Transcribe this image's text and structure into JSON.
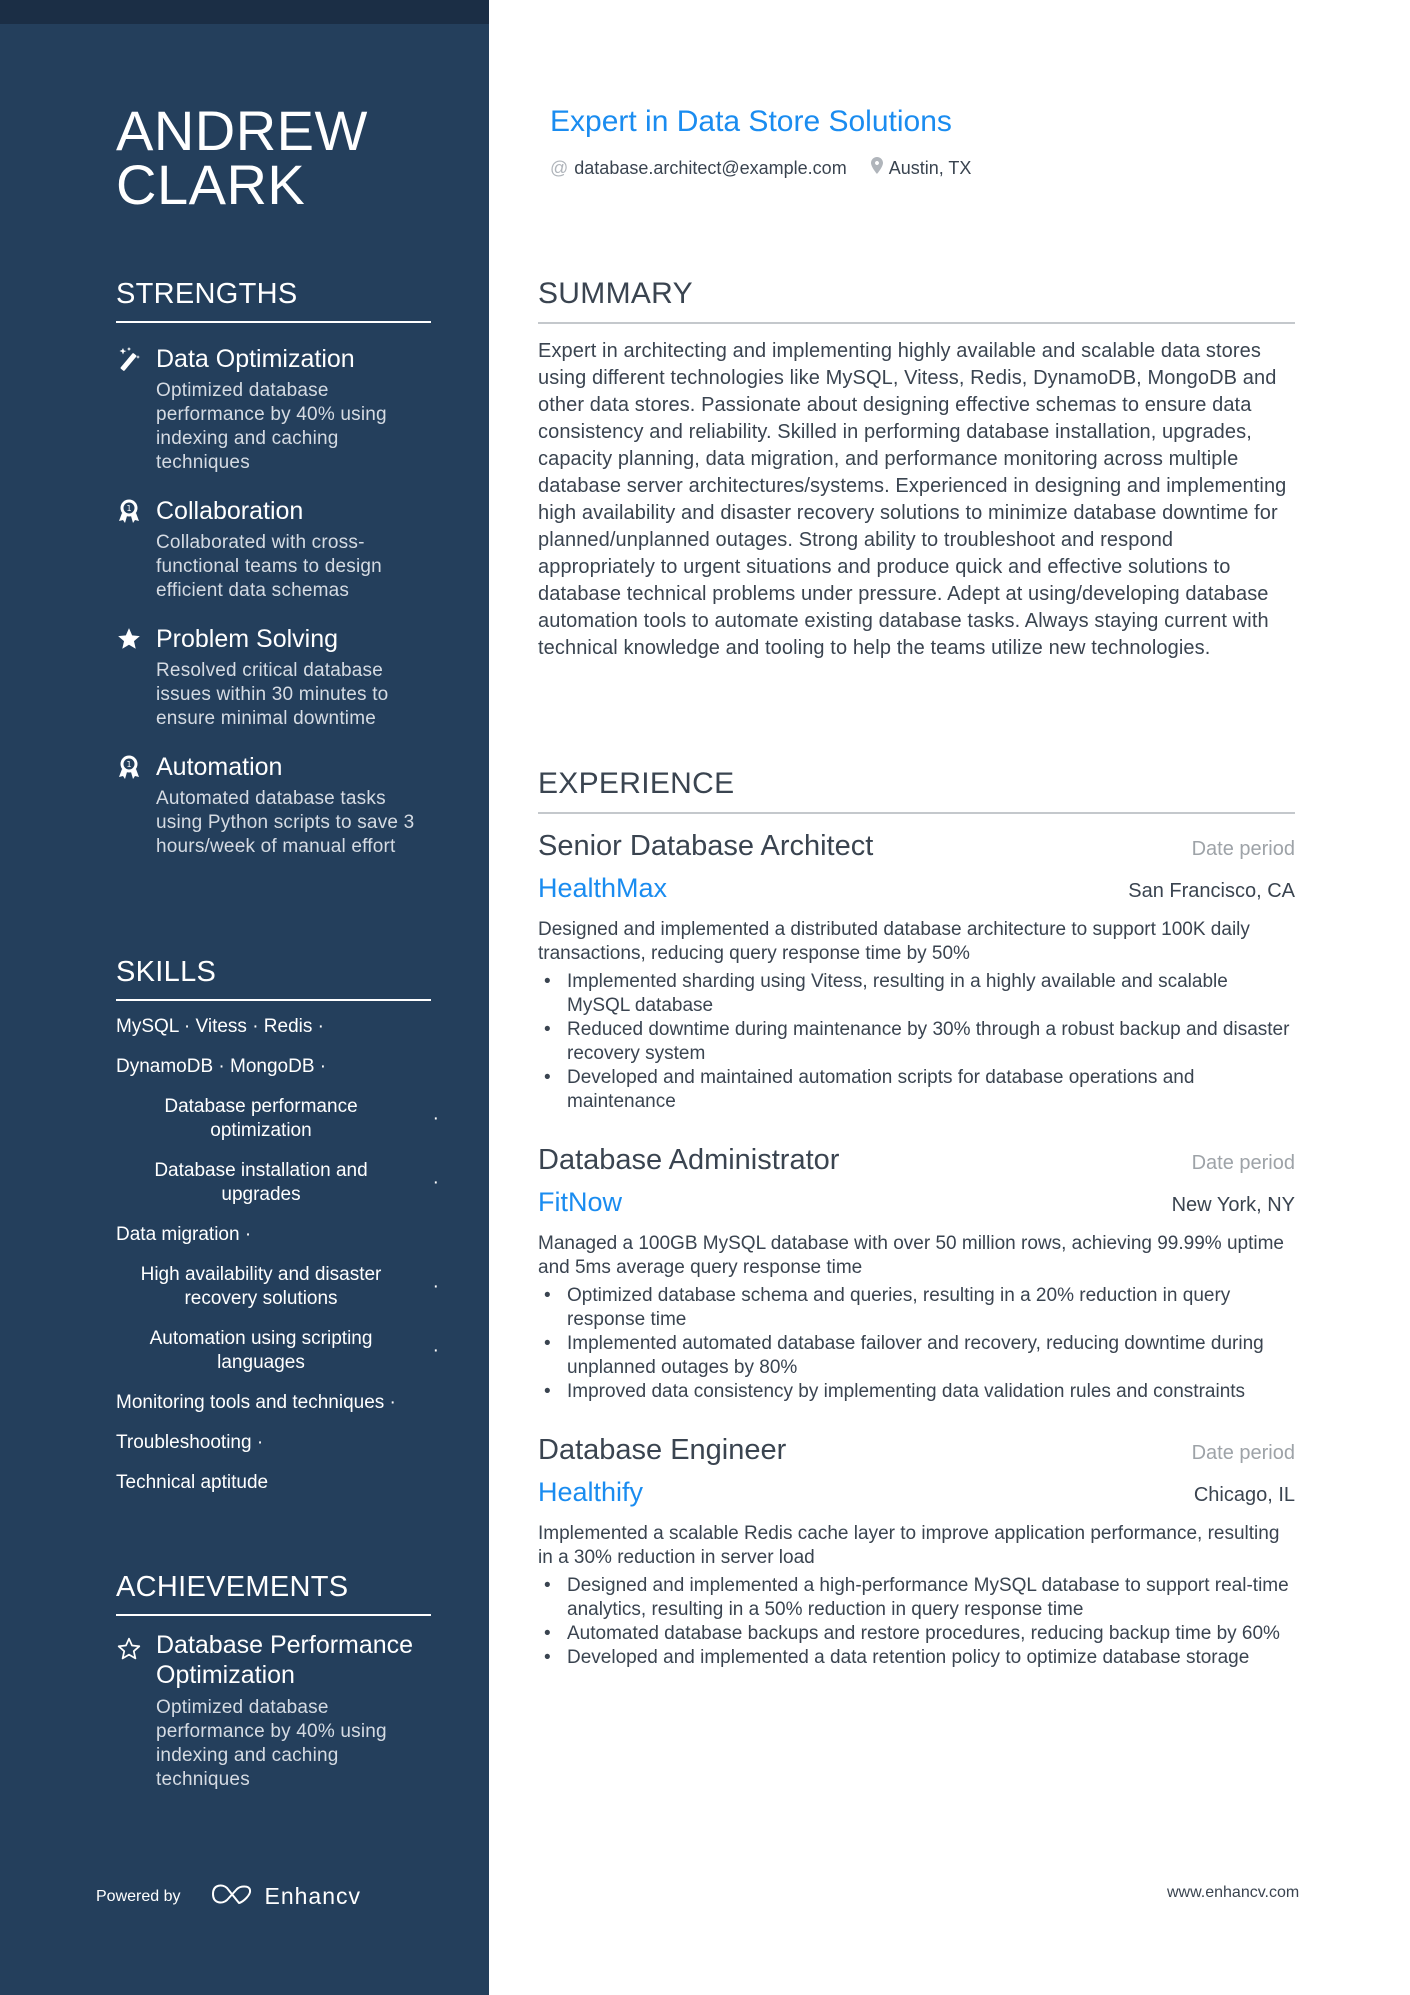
{
  "profile": {
    "name_line1": "ANDREW",
    "name_line2": "CLARK",
    "headline": "Expert in Data Store Solutions",
    "email": "database.architect@example.com",
    "location": "Austin, TX",
    "email_icon": "at-icon",
    "location_icon": "map-pin-icon"
  },
  "colors": {
    "sidebar_bg": "#243f5c",
    "topbar_bg": "#1b2e45",
    "accent": "#1a8cf0",
    "text": "#3a4450",
    "muted": "#9ea3a8"
  },
  "strengths": {
    "heading": "STRENGTHS",
    "items": [
      {
        "icon": "magic-wand-icon",
        "title": "Data Optimization",
        "description": "Optimized database performance by 40% using indexing and caching techniques"
      },
      {
        "icon": "award-ribbon-icon",
        "title": "Collaboration",
        "description": "Collaborated with cross-functional teams to design efficient data schemas"
      },
      {
        "icon": "star-filled-icon",
        "title": "Problem Solving",
        "description": "Resolved critical database issues within 30 minutes to ensure minimal downtime"
      },
      {
        "icon": "award-ribbon-icon",
        "title": "Automation",
        "description": "Automated database tasks using Python scripts to save 3 hours/week of manual effort"
      }
    ]
  },
  "skills": {
    "heading": "SKILLS",
    "lines": [
      {
        "text": "MySQL · Vitess · Redis ·",
        "wrapped": false
      },
      {
        "text": "DynamoDB · MongoDB ·",
        "wrapped": false
      },
      {
        "text": "Database performance optimization",
        "wrapped": true
      },
      {
        "text": "Database installation and upgrades",
        "wrapped": true
      },
      {
        "text": "Data migration ·",
        "wrapped": false
      },
      {
        "text": "High availability and disaster recovery solutions",
        "wrapped": true
      },
      {
        "text": "Automation using scripting languages",
        "wrapped": true
      },
      {
        "text": "Monitoring tools and techniques ·",
        "wrapped": false
      },
      {
        "text": "Troubleshooting ·",
        "wrapped": false
      },
      {
        "text": "Technical aptitude",
        "wrapped": false
      }
    ],
    "separator": "·"
  },
  "achievements": {
    "heading": "ACHIEVEMENTS",
    "items": [
      {
        "icon": "star-outline-icon",
        "title": "Database Performance Optimization",
        "description": "Optimized database performance by 40% using indexing and caching techniques"
      }
    ]
  },
  "summary": {
    "heading": "SUMMARY",
    "text": "Expert in architecting and implementing highly available and scalable data stores using different technologies like MySQL, Vitess, Redis, DynamoDB, MongoDB and other data stores. Passionate about designing effective schemas to ensure data consistency and reliability. Skilled in performing database installation, upgrades, capacity planning, data migration, and performance monitoring across multiple database server architectures/systems. Experienced in designing and implementing high availability and disaster recovery solutions to minimize database downtime for planned/unplanned outages. Strong ability to troubleshoot and respond appropriately to urgent situations and produce quick and effective solutions to database technical problems under pressure. Adept at using/developing database automation tools to automate existing database tasks. Always staying current with technical knowledge and tooling to help the teams utilize new technologies."
  },
  "experience": {
    "heading": "EXPERIENCE",
    "jobs": [
      {
        "title": "Senior Database Architect",
        "date": "Date period",
        "company": "HealthMax",
        "location": "San Francisco, CA",
        "description": "Designed and implemented a distributed database architecture to support 100K daily transactions, reducing query response time by 50%",
        "bullets": [
          "Implemented sharding using Vitess, resulting in a highly available and scalable MySQL database",
          "Reduced downtime during maintenance by 30% through a robust backup and disaster recovery system",
          "Developed and maintained automation scripts for database operations and maintenance"
        ]
      },
      {
        "title": "Database Administrator",
        "date": "Date period",
        "company": "FitNow",
        "location": "New York, NY",
        "description": "Managed a 100GB MySQL database with over 50 million rows, achieving 99.99% uptime and 5ms average query response time",
        "bullets": [
          "Optimized database schema and queries, resulting in a 20% reduction in query response time",
          "Implemented automated database failover and recovery, reducing downtime during unplanned outages by 80%",
          "Improved data consistency by implementing data validation rules and constraints"
        ]
      },
      {
        "title": "Database Engineer",
        "date": "Date period",
        "company": "Healthify",
        "location": "Chicago, IL",
        "description": "Implemented a scalable Redis cache layer to improve application performance, resulting in a 30% reduction in server load",
        "bullets": [
          "Designed and implemented a high-performance MySQL database to support real-time analytics, resulting in a 50% reduction in query response time",
          "Automated database backups and restore procedures, reducing backup time by 60%",
          "Developed and implemented a data retention policy to optimize database storage"
        ]
      }
    ]
  },
  "footer": {
    "powered_by": "Powered by",
    "brand": "Enhancv",
    "brand_icon": "enhancv-logo-icon",
    "url": "www.enhancv.com"
  }
}
